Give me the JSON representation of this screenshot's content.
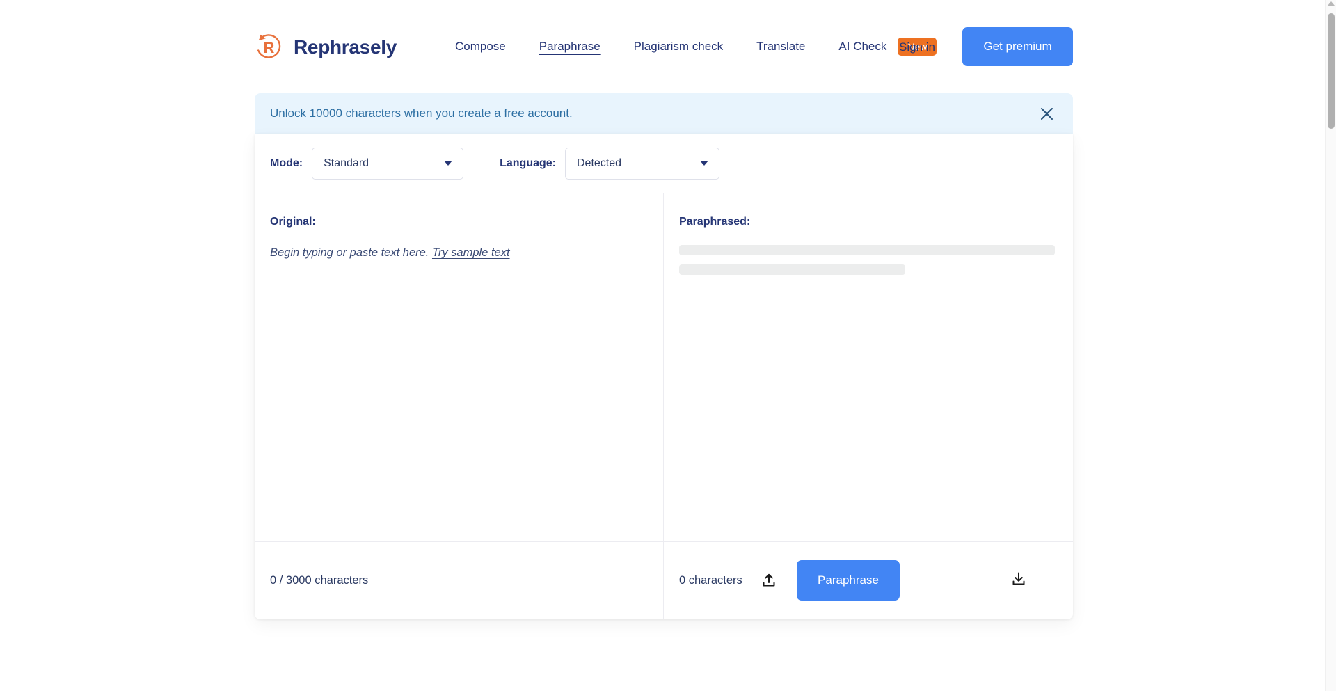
{
  "brand": {
    "name": "Rephrasely",
    "logo_icon": "circular-arrow-r-logo",
    "logo_color": "#E8713C",
    "name_color": "#253575"
  },
  "nav": {
    "items": [
      {
        "label": "Compose",
        "active": false
      },
      {
        "label": "Paraphrase",
        "active": true
      },
      {
        "label": "Plagiarism check",
        "active": false
      },
      {
        "label": "Translate",
        "active": false
      },
      {
        "label": "AI Check",
        "active": false,
        "badge": "New"
      }
    ],
    "badge_color": "#ED7122"
  },
  "account": {
    "sign_in_label": "Sign in",
    "premium_label": "Get premium",
    "premium_color": "#4285F4"
  },
  "banner": {
    "message": "Unlock 10000 characters when you create a free account.",
    "close_icon": "close-icon",
    "background": "#E8F4FD",
    "text_color": "#2d6fa3"
  },
  "options": {
    "mode_label": "Mode:",
    "mode_value": "Standard",
    "language_label": "Language:",
    "language_value": "Detected",
    "caret_icon": "chevron-down-icon"
  },
  "editor": {
    "original_title": "Original:",
    "placeholder_text": "Begin typing or paste text here.",
    "sample_link": "Try sample text",
    "paraphrased_title": "Paraphrased:",
    "skeleton_rows": 2
  },
  "footer": {
    "input_count": "0 / 3000 characters",
    "output_count": "0 characters",
    "upload_icon": "upload-icon",
    "download_icon": "download-icon",
    "paraphrase_label": "Paraphrase",
    "paraphrase_color": "#4285F4"
  }
}
